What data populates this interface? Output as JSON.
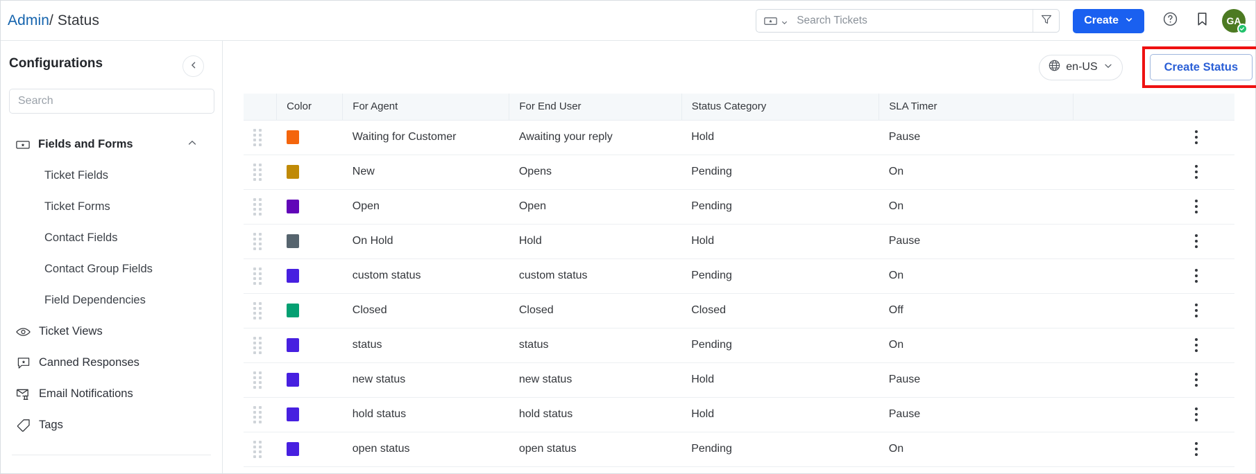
{
  "topbar": {
    "breadcrumb": {
      "root": "Admin",
      "separator": "/",
      "current": "Status"
    },
    "ticket_selector_icon": "ticket-icon",
    "search": {
      "placeholder": "Search Tickets",
      "value": ""
    },
    "filter_icon": "filter-icon",
    "create_button": {
      "label": "Create",
      "chevron_icon": "chevron-down-icon",
      "color": "#1a60f0"
    },
    "help_icon": "help-circle-icon",
    "bookmark_icon": "bookmark-icon",
    "avatar": {
      "initials": "GA",
      "color": "#4c7a22",
      "badge_icon": "check-badge-icon",
      "badge_color": "#21c16b"
    }
  },
  "sidebar": {
    "title": "Configurations",
    "collapse_icon": "chevron-left-icon",
    "search": {
      "placeholder": "Search",
      "value": ""
    },
    "items": [
      {
        "label": "Fields and Forms",
        "icon": "ticket-icon",
        "type": "group",
        "expanded": true,
        "chevron": "chevron-up-icon"
      },
      {
        "label": "Ticket Fields",
        "icon": "",
        "type": "sub"
      },
      {
        "label": "Ticket Forms",
        "icon": "",
        "type": "sub"
      },
      {
        "label": "Contact Fields",
        "icon": "",
        "type": "sub"
      },
      {
        "label": "Contact Group Fields",
        "icon": "",
        "type": "sub"
      },
      {
        "label": "Field Dependencies",
        "icon": "",
        "type": "sub"
      },
      {
        "label": "Ticket Views",
        "icon": "eye-icon",
        "type": "item"
      },
      {
        "label": "Canned Responses",
        "icon": "chat-star-icon",
        "type": "item"
      },
      {
        "label": "Email Notifications",
        "icon": "email-bell-icon",
        "type": "item"
      },
      {
        "label": "Tags",
        "icon": "tag-icon",
        "type": "item"
      }
    ]
  },
  "main": {
    "language_selector": {
      "label": "en-US",
      "icon": "globe-icon",
      "chevron_icon": "chevron-down-icon"
    },
    "create_status_button": {
      "label": "Create Status",
      "color": "#2a5fd6",
      "highlight_color": "#ee1111"
    },
    "table": {
      "columns": [
        "",
        "Color",
        "For Agent",
        "For End User",
        "Status Category",
        "SLA Timer",
        ""
      ],
      "rows": [
        {
          "color": "#f4650c",
          "for_agent": "Waiting for Customer",
          "for_end_user": "Awaiting your reply",
          "status_category": "Hold",
          "sla_timer": "Pause"
        },
        {
          "color": "#c08a06",
          "for_agent": "New",
          "for_end_user": "Opens",
          "status_category": "Pending",
          "sla_timer": "On"
        },
        {
          "color": "#6106b8",
          "for_agent": "Open",
          "for_end_user": "Open",
          "status_category": "Pending",
          "sla_timer": "On"
        },
        {
          "color": "#56646e",
          "for_agent": "On Hold",
          "for_end_user": "Hold",
          "status_category": "Hold",
          "sla_timer": "Pause"
        },
        {
          "color": "#4720e0",
          "for_agent": "custom status",
          "for_end_user": "custom status",
          "status_category": "Pending",
          "sla_timer": "On"
        },
        {
          "color": "#04a072",
          "for_agent": "Closed",
          "for_end_user": "Closed",
          "status_category": "Closed",
          "sla_timer": "Off"
        },
        {
          "color": "#4720e0",
          "for_agent": "status",
          "for_end_user": "status",
          "status_category": "Pending",
          "sla_timer": "On"
        },
        {
          "color": "#4720e0",
          "for_agent": "new status",
          "for_end_user": "new status",
          "status_category": "Hold",
          "sla_timer": "Pause"
        },
        {
          "color": "#4720e0",
          "for_agent": "hold status",
          "for_end_user": "hold status",
          "status_category": "Hold",
          "sla_timer": "Pause"
        },
        {
          "color": "#4720e0",
          "for_agent": "open status",
          "for_end_user": "open status",
          "status_category": "Pending",
          "sla_timer": "On"
        }
      ]
    }
  }
}
